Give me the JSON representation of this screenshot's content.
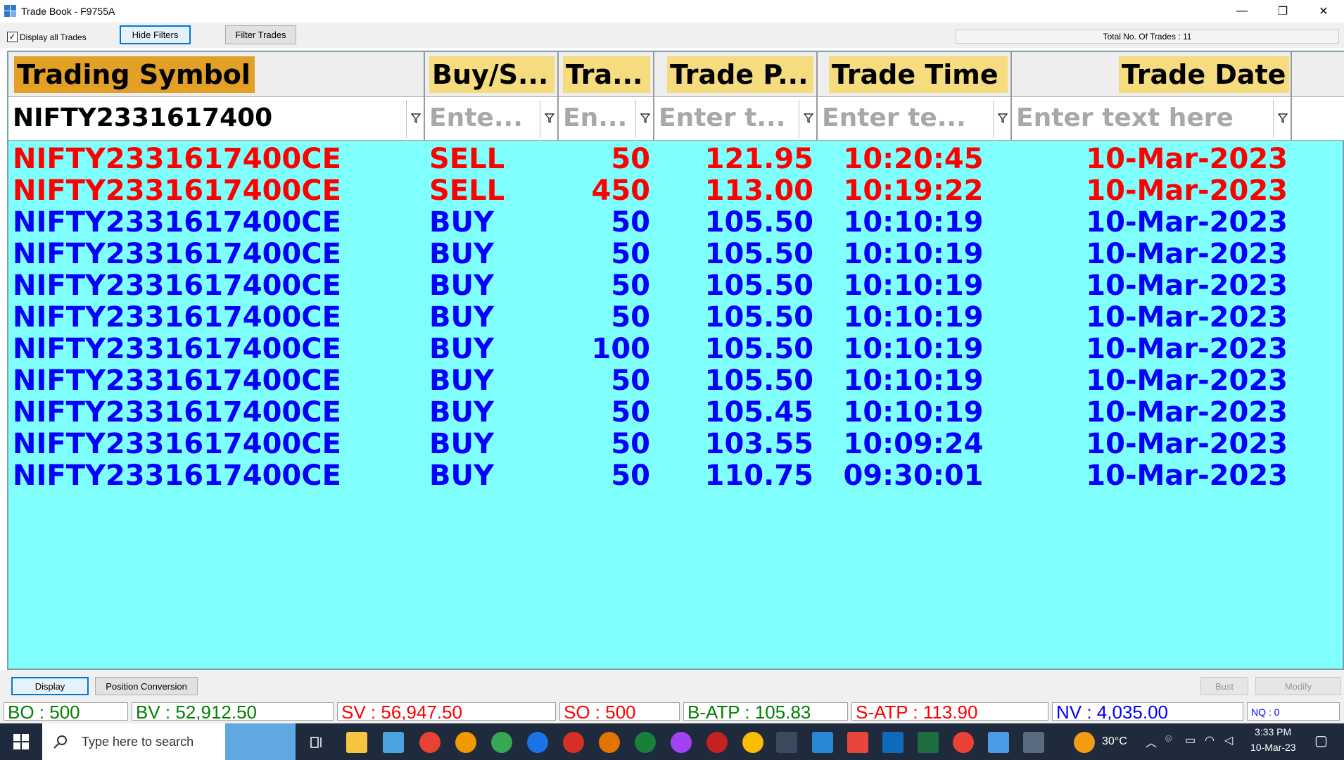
{
  "window": {
    "title": "Trade Book - F9755A",
    "minimize_glyph": "—",
    "maximize_glyph": "❐",
    "close_glyph": "✕"
  },
  "toolbar": {
    "display_all_label": "Display all Trades",
    "display_all_checked": true,
    "hide_filters_label": "Hide Filters",
    "filter_trades_label": "Filter Trades",
    "total_trades_text": "Total No. Of Trades : 11"
  },
  "grid": {
    "columns": [
      {
        "label": "Trading Symbol"
      },
      {
        "label": "Buy/S..."
      },
      {
        "label": "Tra..."
      },
      {
        "label": "Trade P..."
      },
      {
        "label": "Trade Time"
      },
      {
        "label": "Trade Date"
      }
    ],
    "filters": [
      {
        "value": "NIFTY2331617400",
        "placeholder": ""
      },
      {
        "value": "",
        "placeholder": "Ente..."
      },
      {
        "value": "",
        "placeholder": "En..."
      },
      {
        "value": "",
        "placeholder": "Enter t..."
      },
      {
        "value": "",
        "placeholder": "Enter te..."
      },
      {
        "value": "",
        "placeholder": "Enter text here"
      }
    ],
    "rows": [
      {
        "symbol": "NIFTY2331617400CE",
        "side": "SELL",
        "qty": "50",
        "price": "121.95",
        "time": "10:20:45",
        "date": "10-Mar-2023"
      },
      {
        "symbol": "NIFTY2331617400CE",
        "side": "SELL",
        "qty": "450",
        "price": "113.00",
        "time": "10:19:22",
        "date": "10-Mar-2023"
      },
      {
        "symbol": "NIFTY2331617400CE",
        "side": "BUY",
        "qty": "50",
        "price": "105.50",
        "time": "10:10:19",
        "date": "10-Mar-2023"
      },
      {
        "symbol": "NIFTY2331617400CE",
        "side": "BUY",
        "qty": "50",
        "price": "105.50",
        "time": "10:10:19",
        "date": "10-Mar-2023"
      },
      {
        "symbol": "NIFTY2331617400CE",
        "side": "BUY",
        "qty": "50",
        "price": "105.50",
        "time": "10:10:19",
        "date": "10-Mar-2023"
      },
      {
        "symbol": "NIFTY2331617400CE",
        "side": "BUY",
        "qty": "50",
        "price": "105.50",
        "time": "10:10:19",
        "date": "10-Mar-2023"
      },
      {
        "symbol": "NIFTY2331617400CE",
        "side": "BUY",
        "qty": "100",
        "price": "105.50",
        "time": "10:10:19",
        "date": "10-Mar-2023"
      },
      {
        "symbol": "NIFTY2331617400CE",
        "side": "BUY",
        "qty": "50",
        "price": "105.50",
        "time": "10:10:19",
        "date": "10-Mar-2023"
      },
      {
        "symbol": "NIFTY2331617400CE",
        "side": "BUY",
        "qty": "50",
        "price": "105.45",
        "time": "10:10:19",
        "date": "10-Mar-2023"
      },
      {
        "symbol": "NIFTY2331617400CE",
        "side": "BUY",
        "qty": "50",
        "price": "103.55",
        "time": "10:09:24",
        "date": "10-Mar-2023"
      },
      {
        "symbol": "NIFTY2331617400CE",
        "side": "BUY",
        "qty": "50",
        "price": "110.75",
        "time": "09:30:01",
        "date": "10-Mar-2023"
      }
    ]
  },
  "bottom_bar": {
    "display_label": "Display",
    "position_conversion_label": "Position Conversion",
    "bust_label": "Bust",
    "modify_label": "Modify"
  },
  "stats": {
    "bo": "BO : 500",
    "bv": "BV : 52,912.50",
    "sv": "SV : 56,947.50",
    "so": "SO : 500",
    "batp": "B-ATP : 105.83",
    "satp": "S-ATP : 113.90",
    "nv": "NV : 4,035.00",
    "nq": "NQ : 0"
  },
  "taskbar": {
    "search_placeholder": "Type here to search",
    "weather": "30°C",
    "time": "3:33 PM",
    "date": "10-Mar-23"
  },
  "colors": {
    "grid_bg": "#80ffff",
    "sell": "#ff0000",
    "buy": "#0000ff",
    "header_gold": "#e2a126",
    "header_khaki": "#f4dc7f",
    "bo_green": "#008000",
    "sv_red": "#ff0000",
    "nv_blue": "#0000ff",
    "taskbar_bg": "#1f2b3d"
  }
}
